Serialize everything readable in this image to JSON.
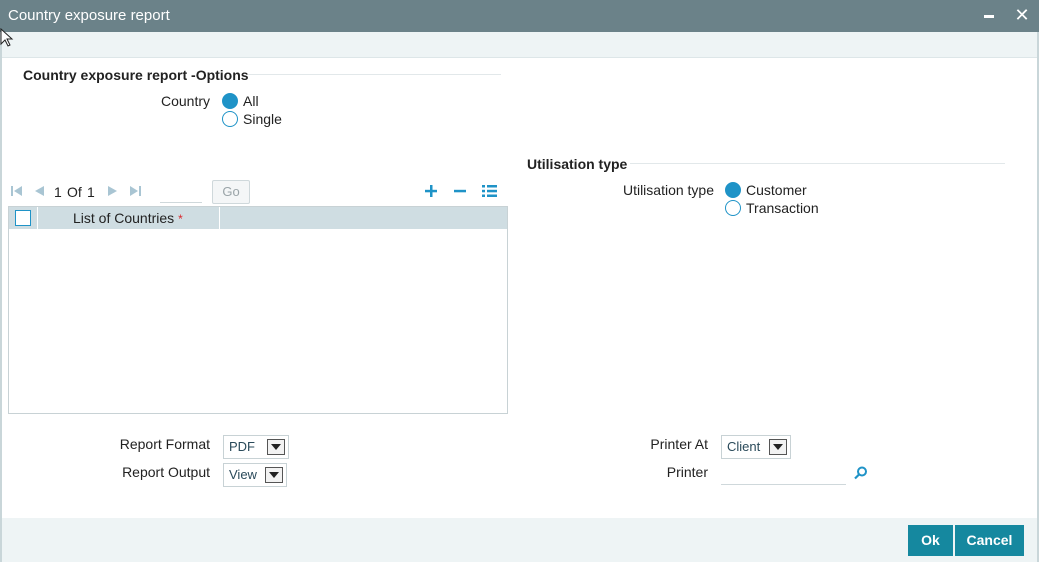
{
  "window": {
    "title": "Country exposure report",
    "close_glyph": "✕"
  },
  "options_section": {
    "title": "Country exposure report -Options",
    "country_label": "Country",
    "country_options": [
      {
        "label": "All",
        "selected": true
      },
      {
        "label": "Single",
        "selected": false
      }
    ]
  },
  "pager": {
    "current": "1",
    "of_label": "Of",
    "total": "1",
    "go_label": "Go",
    "go_value": ""
  },
  "grid": {
    "column": "List of Countries",
    "required_mark": "*",
    "rows": []
  },
  "utilisation_section": {
    "title": "Utilisation type",
    "label": "Utilisation type",
    "options": [
      {
        "label": "Customer",
        "selected": true
      },
      {
        "label": "Transaction",
        "selected": false
      }
    ]
  },
  "report": {
    "format_label": "Report Format",
    "format_value": "PDF",
    "output_label": "Report Output",
    "output_value": "View",
    "printer_at_label": "Printer At",
    "printer_at_value": "Client",
    "printer_label": "Printer",
    "printer_value": ""
  },
  "buttons": {
    "ok": "Ok",
    "cancel": "Cancel"
  },
  "colors": {
    "titlebar": "#6b8289",
    "accent": "#1f93c7",
    "button": "#15889f",
    "grid_header": "#cfdde2"
  }
}
